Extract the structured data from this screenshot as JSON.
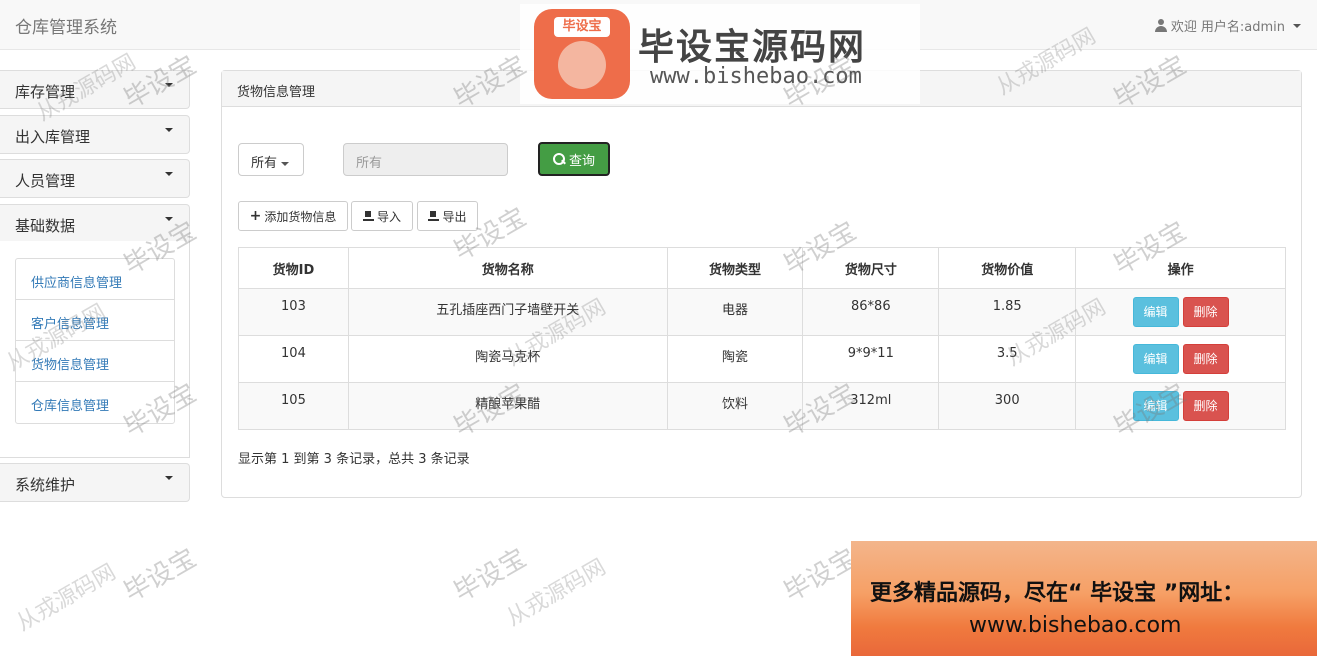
{
  "app": {
    "title": "仓库管理系统"
  },
  "user": {
    "welcome": "欢迎",
    "username": "用户名:admin"
  },
  "logo": {
    "badge": "毕设宝",
    "title": "毕设宝源码网",
    "url": "www.bishebao.com"
  },
  "sidebar": {
    "groups": [
      {
        "label": "库存管理"
      },
      {
        "label": "出入库管理"
      },
      {
        "label": "人员管理"
      },
      {
        "label": "基础数据"
      },
      {
        "label": "系统维护"
      }
    ],
    "sub_items": [
      {
        "label": "供应商信息管理"
      },
      {
        "label": "客户信息管理"
      },
      {
        "label": "货物信息管理"
      },
      {
        "label": "仓库信息管理"
      }
    ]
  },
  "panel": {
    "title": "货物信息管理"
  },
  "search": {
    "filter_label": "所有",
    "placeholder": "所有",
    "query_label": "查询"
  },
  "toolbar": {
    "add_label": "添加货物信息",
    "import_label": "导入",
    "export_label": "导出"
  },
  "table": {
    "headers": [
      "货物ID",
      "货物名称",
      "货物类型",
      "货物尺寸",
      "货物价值",
      "操作"
    ],
    "rows": [
      {
        "id": "103",
        "name": "五孔插座西门子墙壁开关",
        "type": "电器",
        "size": "86*86",
        "value": "1.85",
        "edit": "编辑",
        "delete": "删除"
      },
      {
        "id": "104",
        "name": "陶瓷马克杯",
        "type": "陶瓷",
        "size": "9*9*11",
        "value": "3.5",
        "edit": "编辑",
        "delete": "删除"
      },
      {
        "id": "105",
        "name": "精酿苹果醋",
        "type": "饮料",
        "size": "312ml",
        "value": "300",
        "edit": "编辑",
        "delete": "删除"
      }
    ]
  },
  "pagination": {
    "info": "显示第 1 到第 3 条记录，总共 3 条记录"
  },
  "watermarks": {
    "brand": "毕设宝",
    "site": "从戎源码网"
  },
  "promo": {
    "line1": "更多精品源码，尽在“ 毕设宝 ”网址：",
    "line2": "www.bishebao.com"
  }
}
